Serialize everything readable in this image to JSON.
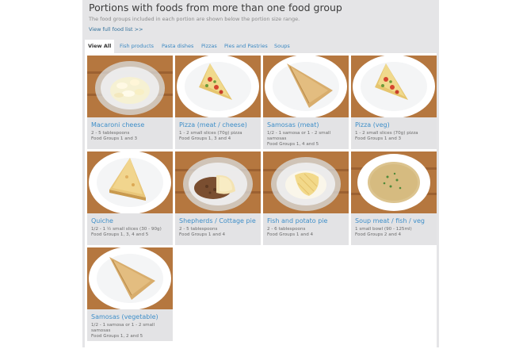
{
  "header": {
    "title": "Portions with foods from more than one food group",
    "subtitle": "The food groups included in each portion are shown below the portion size range.",
    "link": "View full food list >>"
  },
  "tabs": [
    {
      "label": "View All",
      "active": true
    },
    {
      "label": "Fish products",
      "active": false
    },
    {
      "label": "Pasta dishes",
      "active": false
    },
    {
      "label": "Pizzas",
      "active": false
    },
    {
      "label": "Pies and Pastries",
      "active": false
    },
    {
      "label": "Soups",
      "active": false
    }
  ],
  "foods": [
    {
      "name": "Macaroni cheese",
      "portion": "2 - 5 tablespoons",
      "groups": "Food Groups 1 and 3",
      "image": "macaroni-bowl"
    },
    {
      "name": "Pizza (meat / cheese)",
      "portion": "1 - 2 small slices (70g) pizza",
      "groups": "Food Groups 1, 3 and 4",
      "image": "pizza-slice"
    },
    {
      "name": "Samosas (meat)",
      "portion": "1/2 - 1 samosa or 1 - 2 small samosas",
      "groups": "Food Groups 1, 4 and 5",
      "image": "samosa"
    },
    {
      "name": "Pizza (veg)",
      "portion": "1 - 2 small slices (70g) pizza",
      "groups": "Food Groups 1 and 3",
      "image": "pizza-slice"
    },
    {
      "name": "Quiche",
      "portion": "1/2 - 1 ½ small slices (30 - 90g)",
      "groups": "Food Groups 1, 3, 4 and 5",
      "image": "quiche"
    },
    {
      "name": "Shepherds / Cottage pie",
      "portion": "2 - 5 tablespoons",
      "groups": "Food Groups 1 and 4",
      "image": "pie-bowl"
    },
    {
      "name": "Fish and potato pie",
      "portion": "2 - 6 tablespoons",
      "groups": "Food Groups 1 and 4",
      "image": "fish-pie-bowl"
    },
    {
      "name": "Soup meat / fish / veg",
      "portion": "1 small bowl (90 - 125ml)",
      "groups": "Food Groups 2 and 4",
      "image": "soup-bowl"
    },
    {
      "name": "Samosas (vegetable)",
      "portion": "1/2 - 1 samosa or 1 - 2 small samosas",
      "groups": "Food Groups 1, 2 and 5",
      "image": "samosa"
    }
  ],
  "colors": {
    "link": "#3f8fc9",
    "panel": "#e5e5e7",
    "tab_active": "#ffffff"
  }
}
